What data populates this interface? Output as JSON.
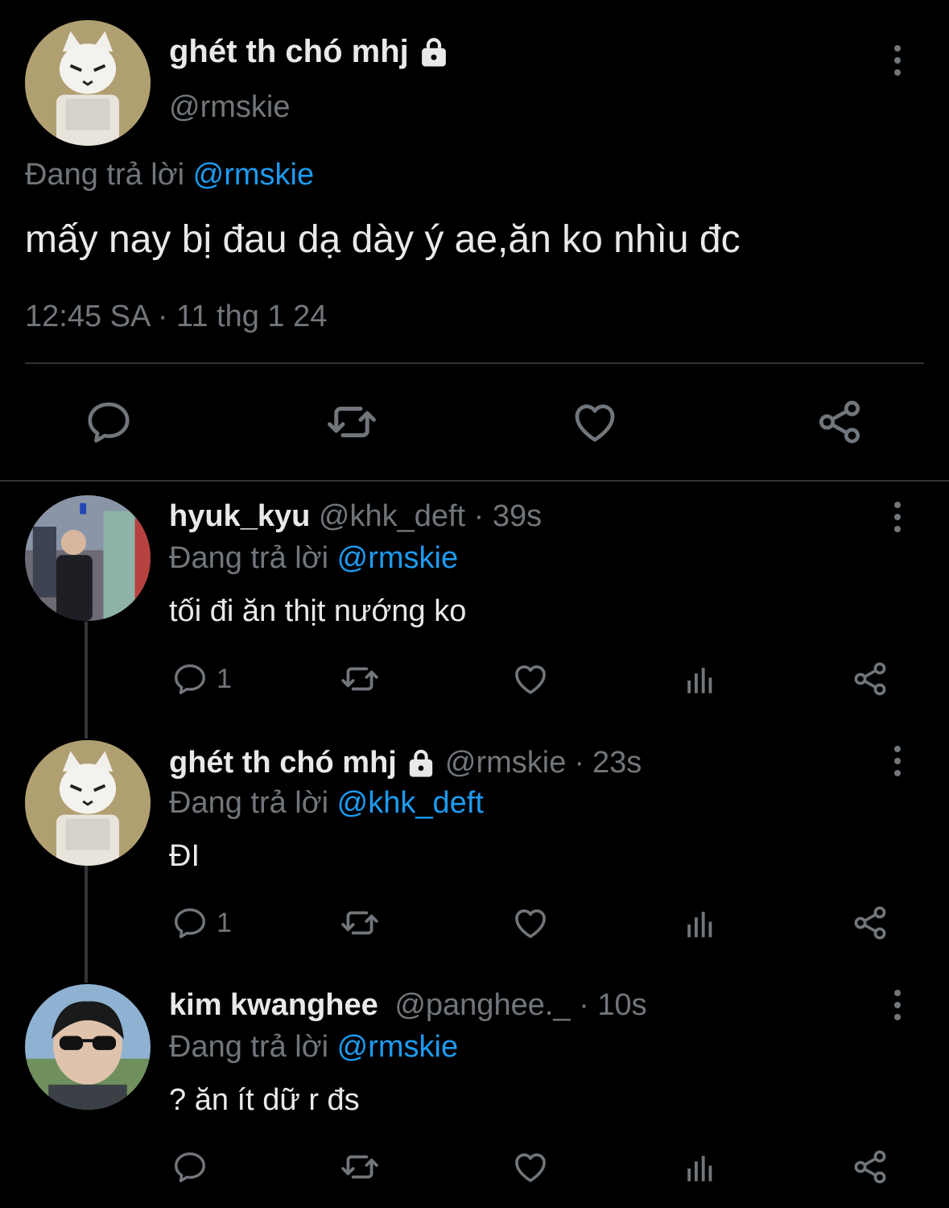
{
  "main_tweet": {
    "display_name": "ghét th chó mhj",
    "handle": "@rmskie",
    "replying_prefix": "Đang trả lời",
    "replying_to": "@rmskie",
    "text": "mấy nay bị đau dạ dày ý ae,ăn ko nhìu đc",
    "time": "12:45 SA",
    "separator": "·",
    "date": "11 thg 1 24"
  },
  "replies": [
    {
      "display_name": "hyuk_kyu",
      "handle": "@khk_deft",
      "separator": "·",
      "age": "39s",
      "replying_prefix": "Đang trả lời",
      "replying_to": "@rmskie",
      "text": "tối đi ăn thịt nướng ko",
      "reply_count": "1"
    },
    {
      "display_name": "ghét th chó mhj",
      "handle": "@rmskie",
      "separator": "·",
      "age": "23s",
      "replying_prefix": "Đang trả lời",
      "replying_to": "@khk_deft",
      "text": "ĐI",
      "reply_count": "1"
    },
    {
      "display_name": "kim kwanghee",
      "handle": "@panghee._",
      "separator": "·",
      "age": "10s",
      "replying_prefix": "Đang trả lời",
      "replying_to": "@rmskie",
      "text": "? ăn ít dữ r đs",
      "reply_count": ""
    }
  ],
  "icons": [
    "lock-icon",
    "more-icon",
    "reply-icon",
    "retweet-icon",
    "like-icon",
    "views-icon",
    "share-icon"
  ],
  "colors": {
    "background": "#000000",
    "text": "#e7e9ea",
    "muted": "#71767b",
    "link": "#1d9bf0",
    "divider": "#2f3336"
  }
}
